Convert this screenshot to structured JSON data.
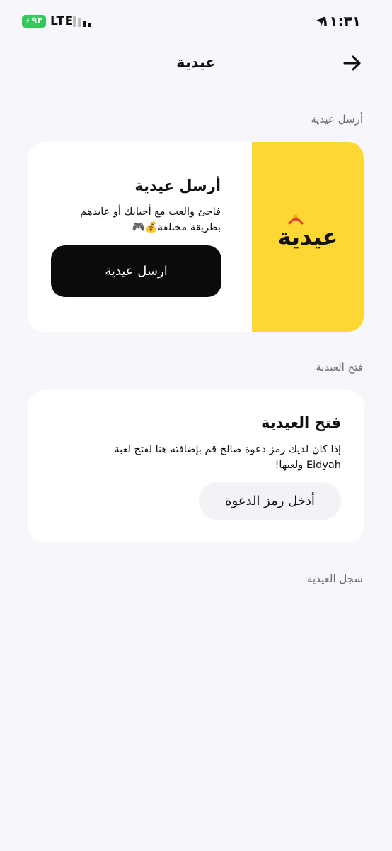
{
  "status_bar": {
    "time": "١١:٣١",
    "battery": "٩٣",
    "network": "LTE"
  },
  "header": {
    "title": "عيدية",
    "back_icon": "arrow-right-icon"
  },
  "send_section": {
    "label": "أرسل عيدية",
    "logo_text": "عيدية",
    "title": "أرسل عيدية",
    "desc_line1": "فاجئ والعب مع أحبابك أو عايدهم",
    "desc_line2": "بطريقة مختلفة💰🎮",
    "button_label": "ارسل عيدية"
  },
  "open_section": {
    "label": "فتح العيدية",
    "title": "فتح العيدية",
    "desc_line1": "إذا كان لديك رمز دعوة صالح قم بإضافته هنا لفتح لعبة",
    "desc_line2": "Eidyah ولعبها!",
    "button_label": "أدخل رمز الدعوة"
  },
  "history_section": {
    "label": "سجل العيدية"
  },
  "colors": {
    "background": "#f6f6fb",
    "card": "#ffffff",
    "brand_yellow": "#fdd835",
    "primary_button": "#0b0b0b",
    "secondary_button": "#f2f2f7",
    "battery": "#34c759",
    "section_label": "#6b6b73"
  }
}
